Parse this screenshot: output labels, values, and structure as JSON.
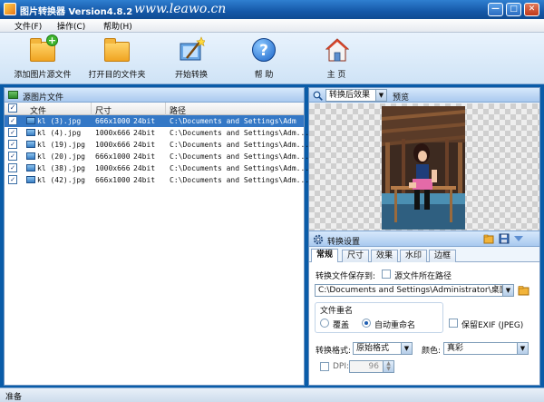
{
  "window": {
    "title": "图片转换器 Version4.8.2",
    "watermark": "www.leawo.cn",
    "min_label": "—",
    "max_label": "□",
    "close_label": "✕"
  },
  "menu": [
    "文件(F)",
    "操作(C)",
    "帮助(H)"
  ],
  "toolbar": {
    "add_source": "添加图片源文件",
    "open_target": "打开目的文件夹",
    "start": "开始转换",
    "help": "帮 助",
    "help_glyph": "?",
    "home": "主 页"
  },
  "source_panel": {
    "title": "源图片文件",
    "columns": [
      "文件",
      "尺寸",
      "路径"
    ],
    "rows": [
      {
        "name": "kl (3).jpg",
        "dims": "666x1000",
        "depth": "24bit",
        "path": "C:\\Documents and Settings\\Adm",
        "selected": true
      },
      {
        "name": "kl (4).jpg",
        "dims": "1000x666",
        "depth": "24bit",
        "path": "C:\\Documents and Settings\\Adm...",
        "selected": false
      },
      {
        "name": "kl (19).jpg",
        "dims": "1000x666",
        "depth": "24bit",
        "path": "C:\\Documents and Settings\\Adm...",
        "selected": false
      },
      {
        "name": "kl (20).jpg",
        "dims": "666x1000",
        "depth": "24bit",
        "path": "C:\\Documents and Settings\\Adm...",
        "selected": false
      },
      {
        "name": "kl (38).jpg",
        "dims": "1000x666",
        "depth": "24bit",
        "path": "C:\\Documents and Settings\\Adm...",
        "selected": false
      },
      {
        "name": "kl (42).jpg",
        "dims": "666x1000",
        "depth": "24bit",
        "path": "C:\\Documents and Settings\\Adm...",
        "selected": false
      }
    ]
  },
  "preview": {
    "mode": "转换后效果",
    "label": "预览"
  },
  "settings": {
    "title": "转换设置",
    "tabs": [
      "常规",
      "尺寸",
      "效果",
      "水印",
      "边框"
    ],
    "active_tab": "常规",
    "save_to_label": "转换文件保存到:",
    "same_path_label": "源文件所在路径",
    "output_path": "C:\\Documents and Settings\\Administrator\\桌面",
    "rename_group": "文件重名",
    "overwrite_label": "覆盖",
    "auto_rename_label": "自动重命名",
    "keep_exif_label": "保留EXIF (JPEG)",
    "format_label": "转换格式:",
    "format_value": "原始格式",
    "color_label": "颜色:",
    "color_value": "真彩",
    "dpi_label": "DPI:",
    "dpi_value": "96"
  },
  "status": "准备",
  "icons": {
    "add": "add-folder-icon",
    "open": "folder-icon",
    "start": "convert-wand-icon",
    "help": "help-icon",
    "home": "home-icon"
  },
  "colors": {
    "title_bar": "#1558a8",
    "selection": "#3478c6",
    "accent": "#0a5ca8"
  }
}
